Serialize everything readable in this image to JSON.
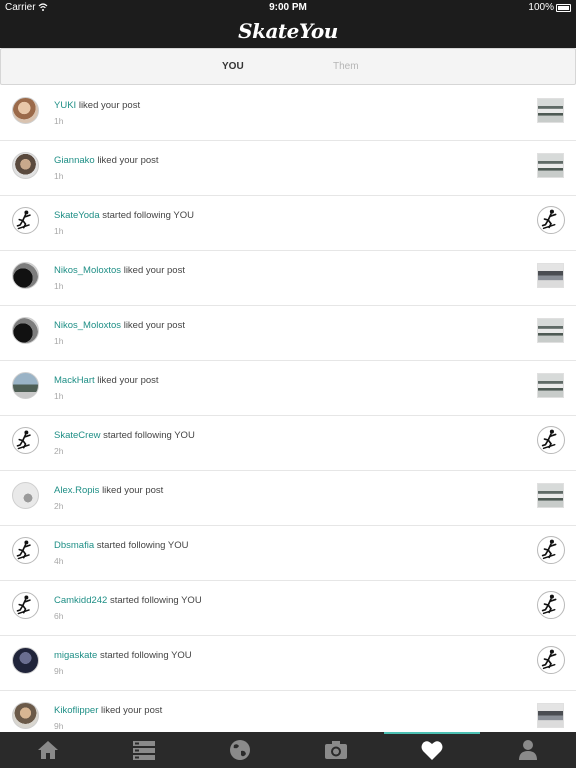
{
  "status_bar": {
    "carrier": "Carrier",
    "time": "9:00 PM",
    "battery": "100%"
  },
  "header": {
    "logo": "SkateYou"
  },
  "segments": {
    "you": "YOU",
    "them": "Them",
    "selected": "YOU"
  },
  "notifications": [
    {
      "user": "YUKI",
      "action": "liked your post",
      "time": "1h",
      "avatar": "photo",
      "thumb": "post"
    },
    {
      "user": "Giannako",
      "action": "liked your post",
      "time": "1h",
      "avatar": "photo",
      "thumb": "post"
    },
    {
      "user": "SkateYoda",
      "action": "started following YOU",
      "time": "1h",
      "avatar": "skater-logo",
      "thumb": "skater-logo"
    },
    {
      "user": "Nikos_Moloxtos",
      "action": "liked your post",
      "time": "1h",
      "avatar": "photo",
      "thumb": "post"
    },
    {
      "user": "Nikos_Moloxtos",
      "action": "liked your post",
      "time": "1h",
      "avatar": "photo",
      "thumb": "post"
    },
    {
      "user": "MackHart",
      "action": "liked your post",
      "time": "1h",
      "avatar": "photo",
      "thumb": "post"
    },
    {
      "user": "SkateCrew",
      "action": "started following YOU",
      "time": "2h",
      "avatar": "skater-logo",
      "thumb": "skater-logo"
    },
    {
      "user": "Alex.Ropis",
      "action": "liked your post",
      "time": "2h",
      "avatar": "photo",
      "thumb": "post"
    },
    {
      "user": "Dbsmafia",
      "action": "started following YOU",
      "time": "4h",
      "avatar": "skater-logo",
      "thumb": "skater-logo"
    },
    {
      "user": "Camkidd242",
      "action": "started following YOU",
      "time": "6h",
      "avatar": "skater-logo",
      "thumb": "skater-logo"
    },
    {
      "user": "migaskate",
      "action": "started following YOU",
      "time": "9h",
      "avatar": "photo",
      "thumb": "skater-logo"
    },
    {
      "user": "Kikoflipper",
      "action": "liked your post",
      "time": "9h",
      "avatar": "photo",
      "thumb": "post"
    }
  ],
  "tab_bar": {
    "items": [
      "home-icon",
      "feed-list-icon",
      "globe-icon",
      "camera-icon",
      "heart-icon",
      "profile-icon"
    ],
    "selected": "heart-icon"
  },
  "colors": {
    "accent": "#1f8f86",
    "tab_active": "#4bbfb2",
    "bar_background": "#1c1c1c"
  }
}
